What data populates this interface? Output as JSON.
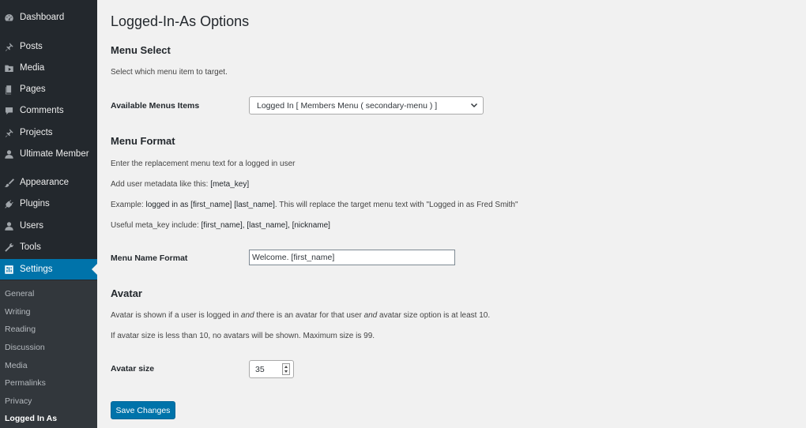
{
  "sidebar": {
    "items": [
      {
        "label": "Dashboard",
        "icon": "dashboard-icon"
      },
      {
        "label": "Posts",
        "icon": "pin-icon"
      },
      {
        "label": "Media",
        "icon": "media-icon"
      },
      {
        "label": "Pages",
        "icon": "pages-icon"
      },
      {
        "label": "Comments",
        "icon": "comment-icon"
      },
      {
        "label": "Projects",
        "icon": "pin-icon"
      },
      {
        "label": "Ultimate Member",
        "icon": "user-icon"
      },
      {
        "label": "Appearance",
        "icon": "brush-icon"
      },
      {
        "label": "Plugins",
        "icon": "plugin-icon"
      },
      {
        "label": "Users",
        "icon": "users-icon"
      },
      {
        "label": "Tools",
        "icon": "wrench-icon"
      },
      {
        "label": "Settings",
        "icon": "settings-icon",
        "active": true
      }
    ],
    "submenu": [
      "General",
      "Writing",
      "Reading",
      "Discussion",
      "Media",
      "Permalinks",
      "Privacy",
      "Logged In As"
    ]
  },
  "page": {
    "title": "Logged-In-As Options",
    "menu_select": {
      "heading": "Menu Select",
      "description": "Select which menu item to target.",
      "label": "Available Menus Items",
      "selected": "Logged In [ Members Menu ( secondary-menu ) ]"
    },
    "menu_format": {
      "heading": "Menu Format",
      "line1": "Enter the replacement menu text for a logged in user",
      "line2_prefix": "Add user metadata like this: ",
      "line2_code": "[meta_key]",
      "line3_prefix": "Example: ",
      "line3_code": "logged in as [first_name] [last_name]",
      "line3_suffix": ". This will replace the target menu text with \"Logged in as Fred Smith\"",
      "line4_prefix": "Useful meta_key include: ",
      "line4_code": "[first_name], [last_name], [nickname]",
      "label": "Menu Name Format",
      "value": "Welcome. [first_name]"
    },
    "avatar": {
      "heading": "Avatar",
      "line1_a": "Avatar is shown if a user is logged in ",
      "line1_em1": "and",
      "line1_b": " there is an avatar for that user ",
      "line1_em2": "and",
      "line1_c": " avatar size option is at least 10.",
      "line2": "If avatar size is less than 10, no avatars will be shown. Maximum size is 99.",
      "label": "Avatar size",
      "value": "35"
    },
    "save_label": "Save Changes"
  },
  "colors": {
    "sidebar_bg": "#23282d",
    "submenu_bg": "#32373c",
    "accent": "#0073aa",
    "page_bg": "#f1f1f1"
  }
}
